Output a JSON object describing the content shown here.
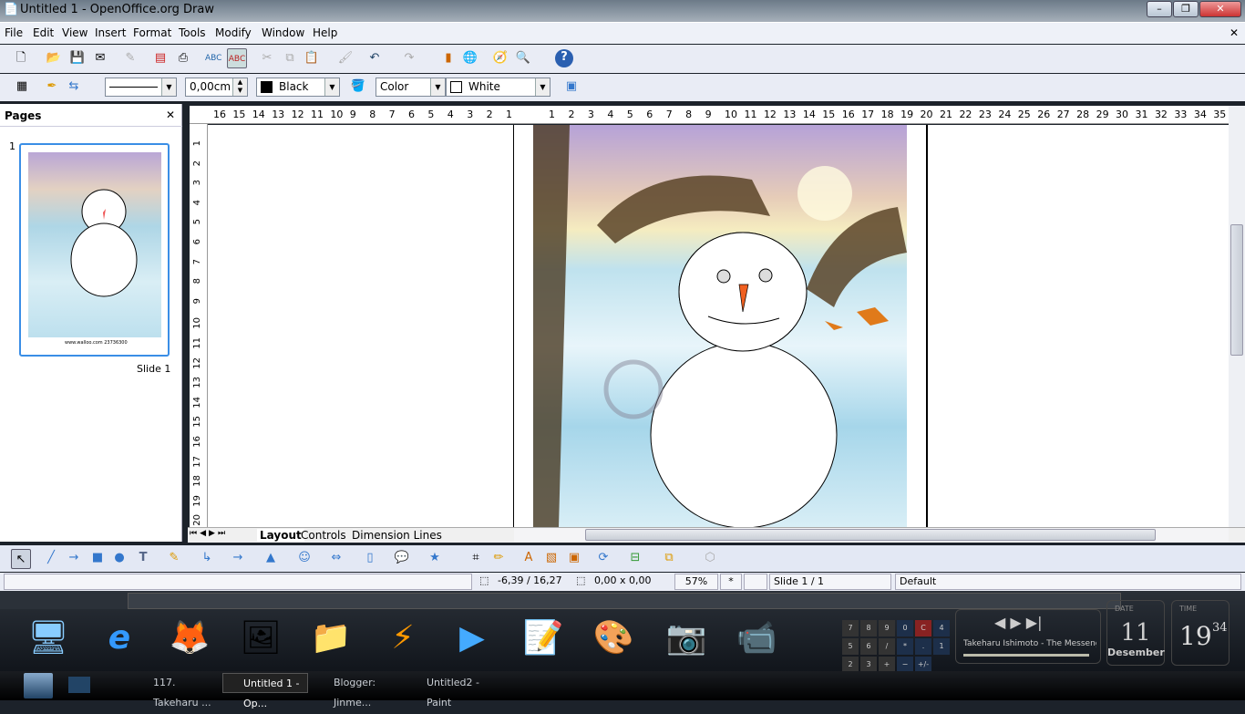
{
  "window": {
    "title": "Untitled 1 - OpenOffice.org Draw",
    "minimize": "–",
    "maximize": "❐",
    "close": "✕"
  },
  "menu": [
    "File",
    "Edit",
    "View",
    "Insert",
    "Format",
    "Tools",
    "Modify",
    "Window",
    "Help"
  ],
  "menu_close": "✕",
  "toolbar2": {
    "line_width": "0,00cm",
    "line_color": "Black",
    "area_style": "Color",
    "area_color": "White"
  },
  "colors": {
    "line_color": "#000000",
    "area_color": "#ffffff",
    "accent": "#3a7bd5"
  },
  "pages_panel": {
    "title": "Pages",
    "close": "✕",
    "slide_number": "1",
    "slide_label": "Slide 1",
    "thumb_caption": "www.walloo.com 23736300"
  },
  "ruler_h": {
    "left": [
      "16",
      "15",
      "14",
      "13",
      "12",
      "11",
      "10",
      "9",
      "8",
      "7",
      "6",
      "5",
      "4",
      "3",
      "2",
      "1"
    ],
    "right": [
      "1",
      "2",
      "3",
      "4",
      "5",
      "6",
      "7",
      "8",
      "9",
      "10",
      "11",
      "12",
      "13",
      "14",
      "15",
      "16",
      "17",
      "18",
      "19",
      "20",
      "21",
      "22",
      "23",
      "24",
      "25",
      "26",
      "27",
      "28",
      "29",
      "30",
      "31",
      "32",
      "33",
      "34",
      "35"
    ]
  },
  "ruler_v": [
    "1",
    "2",
    "3",
    "4",
    "5",
    "6",
    "7",
    "8",
    "9",
    "10",
    "11",
    "12",
    "13",
    "14",
    "15",
    "16",
    "17",
    "18",
    "19",
    "20"
  ],
  "layer_tabs": [
    "Layout",
    "Controls",
    "Dimension Lines"
  ],
  "status": {
    "position": "-6,39 / 16,27",
    "size": "0,00 x 0,00",
    "zoom": "57%",
    "modified": "*",
    "slide": "Slide 1 / 1",
    "layout": "Default"
  },
  "widgets": {
    "calc_keys": [
      "7",
      "8",
      "9",
      "0",
      "C",
      "4",
      "5",
      "6",
      "/",
      "*",
      ".",
      "1",
      "2",
      "3",
      "+",
      "−",
      "+/-"
    ],
    "now_playing": "Takeharu Ishimoto - The Messeng",
    "date_label": "DATE",
    "date_day": "11",
    "date_month": "Desember",
    "time_label": "TIME",
    "time_hour": "19",
    "time_min": "34"
  },
  "taskbar": [
    "117. Takeharu ...",
    "Untitled 1 - Op...",
    "Blogger: Jinme...",
    "Untitled2 - Paint"
  ]
}
